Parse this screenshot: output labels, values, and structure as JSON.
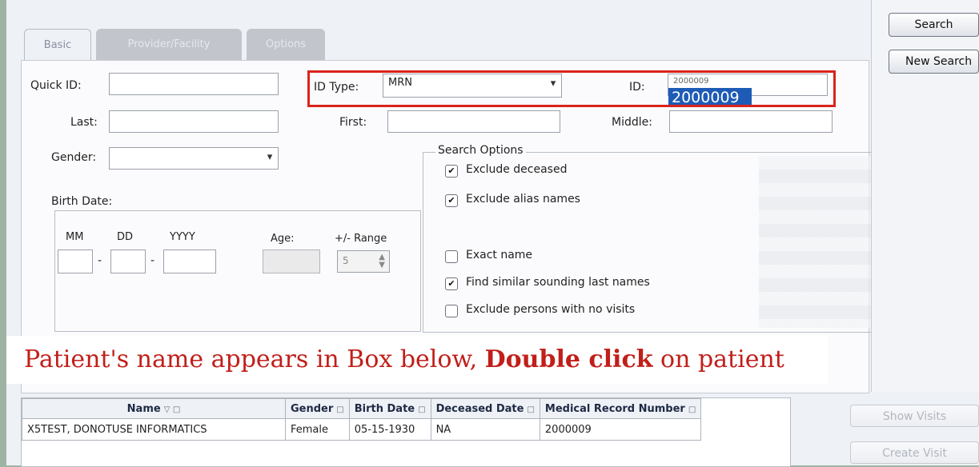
{
  "tabs": [
    "Basic",
    "Provider/Facility",
    "Options"
  ],
  "fields": {
    "quick_id": {
      "label": "Quick ID:",
      "value": ""
    },
    "id_type": {
      "label": "ID Type:",
      "value": "MRN"
    },
    "id": {
      "label": "ID:",
      "value": "2000009",
      "overlay": "2000009"
    },
    "last": {
      "label": "Last:",
      "value": ""
    },
    "first": {
      "label": "First:",
      "value": ""
    },
    "middle": {
      "label": "Middle:",
      "value": ""
    },
    "gender": {
      "label": "Gender:",
      "value": ""
    }
  },
  "birth_date": {
    "label": "Birth Date:",
    "mm": "MM",
    "dd": "DD",
    "yyyy": "YYYY",
    "age": "Age:",
    "range": "+/- Range",
    "range_value": "5"
  },
  "search_options": {
    "title": "Search Options",
    "items": [
      {
        "label": "Exclude deceased",
        "checked": true
      },
      {
        "label": "Exclude alias names",
        "checked": true
      },
      {
        "label": "Exact name",
        "checked": false
      },
      {
        "label": "Find similar sounding last names",
        "checked": true
      },
      {
        "label": "Exclude persons with no visits",
        "checked": false
      }
    ]
  },
  "instruction": {
    "prefix": "Patient's name appears in Box below, ",
    "bold": "Double click",
    "suffix": " on patient"
  },
  "buttons": {
    "search": "Search",
    "new_search": "New Search",
    "show_visits": "Show Visits",
    "create_visit": "Create Visit"
  },
  "results": {
    "columns": [
      "Name",
      "Gender",
      "Birth Date",
      "Deceased Date",
      "Medical Record Number"
    ],
    "rows": [
      [
        "X5TEST, DONOTUSE INFORMATICS",
        "Female",
        "05-15-1930",
        "NA",
        "2000009"
      ]
    ]
  },
  "colors": {
    "highlight_box": "#d9241b",
    "instruction_text": "#c11f1a",
    "selection": "#1e5bb6"
  }
}
